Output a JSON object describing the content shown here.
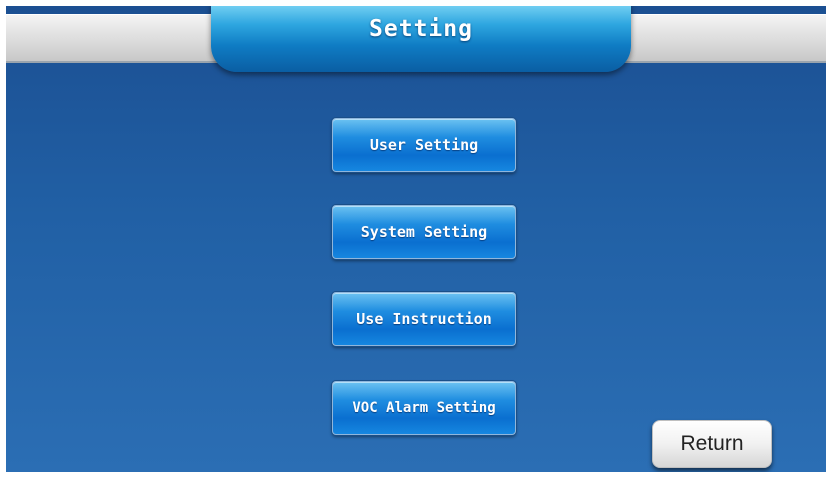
{
  "header": {
    "title": "Setting"
  },
  "menu": {
    "items": [
      {
        "label": "User Setting"
      },
      {
        "label": "System Setting"
      },
      {
        "label": "Use Instruction"
      },
      {
        "label": "VOC Alarm Setting"
      }
    ]
  },
  "footer": {
    "return_label": "Return"
  },
  "colors": {
    "background": "#2160a5",
    "button": "#1f8de0",
    "title_tab": "#2ea6e0",
    "header_bar": "#dcdcdc"
  }
}
